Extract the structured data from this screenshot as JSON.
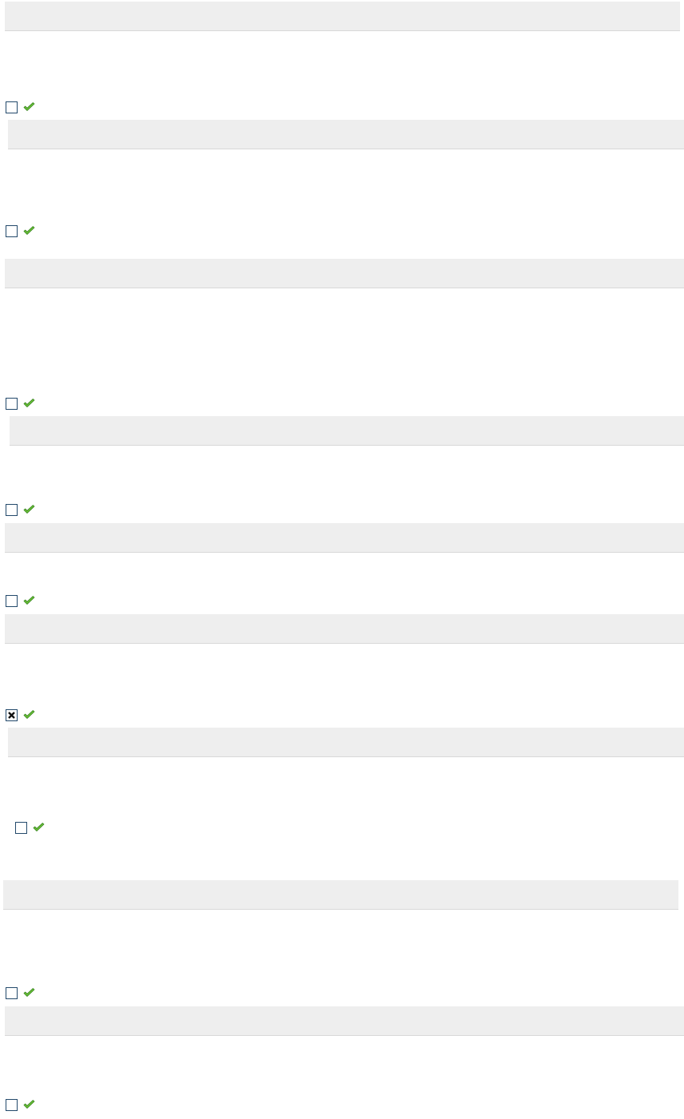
{
  "colors": {
    "bar_background": "#eeeeee",
    "bar_border": "#d8d8d8",
    "checkbox_border": "#23496b",
    "check_fill": "#6cc23a",
    "check_stroke": "#2f7d16"
  },
  "items": [
    {
      "checked": false,
      "icon": "green-check-icon"
    },
    {
      "checked": false,
      "icon": "green-check-icon"
    },
    {
      "checked": false,
      "icon": "green-check-icon"
    },
    {
      "checked": false,
      "icon": "green-check-icon"
    },
    {
      "checked": false,
      "icon": "green-check-icon"
    },
    {
      "checked": true,
      "icon": "green-check-icon"
    },
    {
      "checked": false,
      "icon": "green-check-icon"
    },
    {
      "checked": false,
      "icon": "green-check-icon"
    },
    {
      "checked": false,
      "icon": "green-check-icon"
    }
  ]
}
